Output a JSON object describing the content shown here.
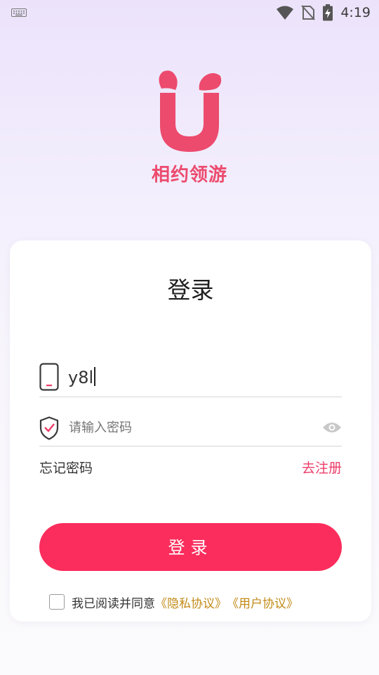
{
  "status_bar": {
    "time": "4:19",
    "icons": [
      "keyboard-icon",
      "wifi-icon",
      "no-sim-icon",
      "battery-charging-icon"
    ]
  },
  "app": {
    "brand_name": "相约领游",
    "brand_color": "#ec4b6e",
    "accent_color": "#fb2d5c"
  },
  "login_card": {
    "title": "登录",
    "phone_field": {
      "value": "y8l",
      "icon": "phone-icon"
    },
    "password_field": {
      "placeholder": "请输入密码",
      "icon": "shield-check-icon",
      "toggle_icon": "eye-icon"
    },
    "forgot_password": "忘记密码",
    "register_link": "去注册",
    "login_button": "登录",
    "agreement": {
      "text": "我已阅读并同意",
      "privacy_link": "《隐私协议》",
      "user_link": "《用户协议》",
      "checked": false
    }
  }
}
